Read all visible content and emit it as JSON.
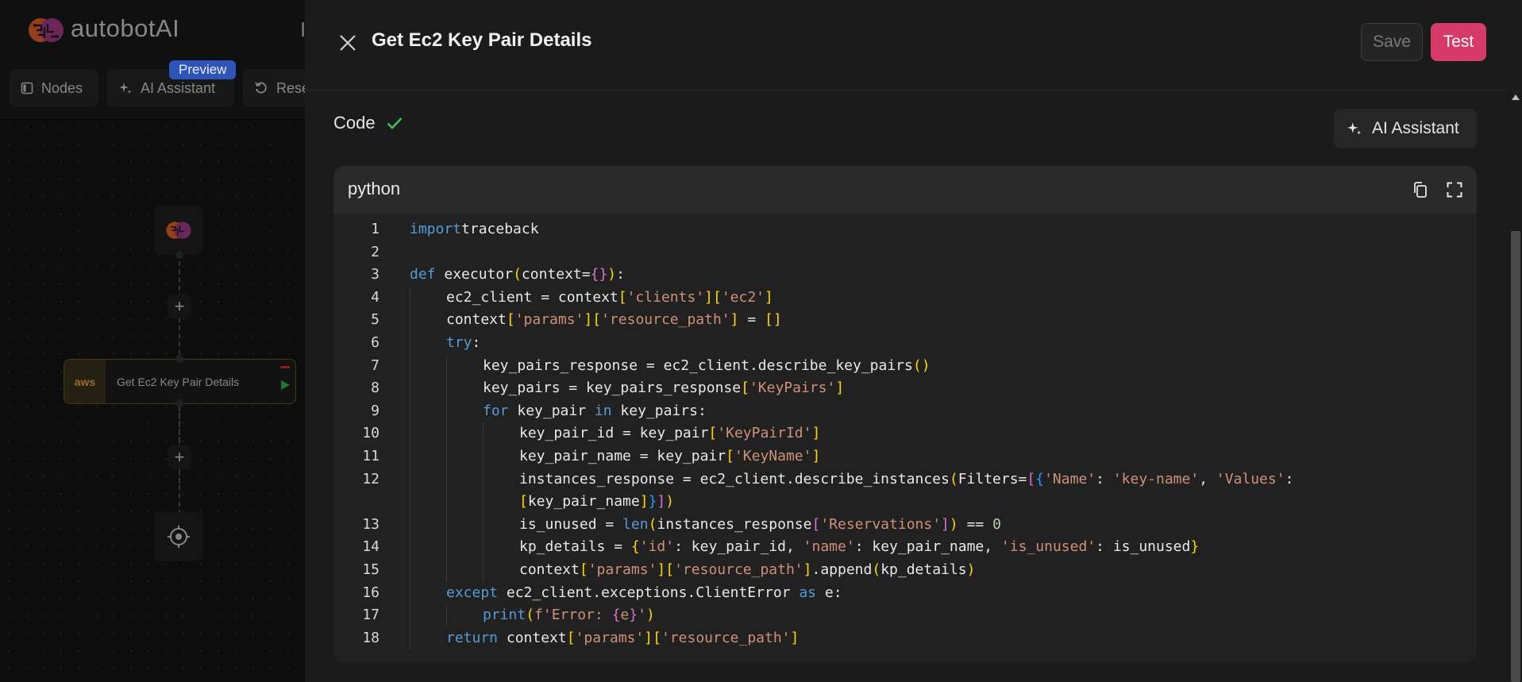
{
  "app": {
    "brand": "autobotAI",
    "header_cut": "I",
    "toolbar": {
      "nodes_label": "Nodes",
      "ai_assistant_label": "AI Assistant",
      "reset_label": "Rese",
      "preview_badge": "Preview"
    },
    "flow": {
      "step_label": "Get Ec2 Key Pair Details",
      "aws_badge": "aws"
    }
  },
  "drawer": {
    "title": "Get Ec2 Key Pair Details",
    "save_label": "Save",
    "test_label": "Test",
    "section_label": "Code",
    "ai_assistant_label": "AI Assistant",
    "editor": {
      "language": "python"
    }
  },
  "colors": {
    "accent": "#d63a68",
    "success": "#3fbf5f",
    "keyword": "#569cd6",
    "string": "#ce9178",
    "number": "#b5cea8",
    "bracket": "#ffd700"
  },
  "code_lines": [
    {
      "n": "1",
      "indent": 0,
      "tokens": [
        [
          "kw",
          "import"
        ],
        [
          "",
          "traceback"
        ]
      ]
    },
    {
      "n": "2",
      "indent": 0,
      "tokens": []
    },
    {
      "n": "3",
      "indent": 0,
      "tokens": [
        [
          "kw",
          "def"
        ],
        [
          "",
          " executor"
        ],
        [
          "br1",
          "("
        ],
        [
          "",
          "context="
        ],
        [
          "br2",
          "{}"
        ],
        [
          "br1",
          ")"
        ],
        [
          "",
          ":"
        ]
      ]
    },
    {
      "n": "4",
      "indent": 1,
      "tokens": [
        [
          "",
          "ec2_client = context"
        ],
        [
          "br1",
          "["
        ],
        [
          "str",
          "'clients'"
        ],
        [
          "br1",
          "]["
        ],
        [
          "str",
          "'ec2'"
        ],
        [
          "br1",
          "]"
        ]
      ]
    },
    {
      "n": "5",
      "indent": 1,
      "tokens": [
        [
          "",
          "context"
        ],
        [
          "br1",
          "["
        ],
        [
          "str",
          "'params'"
        ],
        [
          "br1",
          "]["
        ],
        [
          "str",
          "'resource_path'"
        ],
        [
          "br1",
          "]"
        ],
        [
          "",
          " = "
        ],
        [
          "br1",
          "[]"
        ]
      ]
    },
    {
      "n": "6",
      "indent": 1,
      "tokens": [
        [
          "kw",
          "try"
        ],
        [
          "",
          ":"
        ]
      ]
    },
    {
      "n": "7",
      "indent": 2,
      "tokens": [
        [
          "",
          "key_pairs_response = ec2_client.describe_key_pairs"
        ],
        [
          "br1",
          "()"
        ]
      ]
    },
    {
      "n": "8",
      "indent": 2,
      "tokens": [
        [
          "",
          "key_pairs = key_pairs_response"
        ],
        [
          "br1",
          "["
        ],
        [
          "str",
          "'KeyPairs'"
        ],
        [
          "br1",
          "]"
        ]
      ]
    },
    {
      "n": "9",
      "indent": 2,
      "tokens": [
        [
          "kw",
          "for"
        ],
        [
          "",
          " key_pair "
        ],
        [
          "kw",
          "in"
        ],
        [
          "",
          " key_pairs:"
        ]
      ]
    },
    {
      "n": "10",
      "indent": 3,
      "tokens": [
        [
          "",
          "key_pair_id = key_pair"
        ],
        [
          "br1",
          "["
        ],
        [
          "str",
          "'KeyPairId'"
        ],
        [
          "br1",
          "]"
        ]
      ]
    },
    {
      "n": "11",
      "indent": 3,
      "tokens": [
        [
          "",
          "key_pair_name = key_pair"
        ],
        [
          "br1",
          "["
        ],
        [
          "str",
          "'KeyName'"
        ],
        [
          "br1",
          "]"
        ]
      ]
    },
    {
      "n": "12",
      "indent": 3,
      "tokens": [
        [
          "",
          "instances_response = ec2_client.describe_instances"
        ],
        [
          "br1",
          "("
        ],
        [
          "",
          "Filters="
        ],
        [
          "br2",
          "["
        ],
        [
          "br3",
          "{"
        ],
        [
          "str",
          "'Name'"
        ],
        [
          "",
          ": "
        ],
        [
          "str",
          "'key-name'"
        ],
        [
          "",
          ", "
        ],
        [
          "str",
          "'Values'"
        ],
        [
          "",
          ":"
        ]
      ]
    },
    {
      "n": "",
      "indent": 3,
      "tokens": [
        [
          "br1",
          "["
        ],
        [
          "",
          "key_pair_name"
        ],
        [
          "br1",
          "]"
        ],
        [
          "br3",
          "}"
        ],
        [
          "br2",
          "]"
        ],
        [
          "br1",
          ")"
        ]
      ]
    },
    {
      "n": "13",
      "indent": 3,
      "tokens": [
        [
          "",
          "is_unused = "
        ],
        [
          "bi",
          "len"
        ],
        [
          "br1",
          "("
        ],
        [
          "",
          "instances_response"
        ],
        [
          "br2",
          "["
        ],
        [
          "str",
          "'Reservations'"
        ],
        [
          "br2",
          "]"
        ],
        [
          "br1",
          ")"
        ],
        [
          "",
          " == "
        ],
        [
          "num",
          "0"
        ]
      ]
    },
    {
      "n": "14",
      "indent": 3,
      "tokens": [
        [
          "",
          "kp_details = "
        ],
        [
          "br1",
          "{"
        ],
        [
          "str",
          "'id'"
        ],
        [
          "",
          ": key_pair_id, "
        ],
        [
          "str",
          "'name'"
        ],
        [
          "",
          ": key_pair_name, "
        ],
        [
          "str",
          "'is_unused'"
        ],
        [
          "",
          ": is_unused"
        ],
        [
          "br1",
          "}"
        ]
      ]
    },
    {
      "n": "15",
      "indent": 3,
      "tokens": [
        [
          "",
          "context"
        ],
        [
          "br1",
          "["
        ],
        [
          "str",
          "'params'"
        ],
        [
          "br1",
          "]["
        ],
        [
          "str",
          "'resource_path'"
        ],
        [
          "br1",
          "]"
        ],
        [
          "",
          ".append"
        ],
        [
          "br1",
          "("
        ],
        [
          "",
          "kp_details"
        ],
        [
          "br1",
          ")"
        ]
      ]
    },
    {
      "n": "16",
      "indent": 1,
      "tokens": [
        [
          "kw",
          "except"
        ],
        [
          "",
          " ec2_client.exceptions.ClientError "
        ],
        [
          "kw",
          "as"
        ],
        [
          "",
          " e:"
        ]
      ]
    },
    {
      "n": "17",
      "indent": 2,
      "tokens": [
        [
          "bi",
          "print"
        ],
        [
          "br1",
          "("
        ],
        [
          "str",
          "f'Error: "
        ],
        [
          "br2",
          "{"
        ],
        [
          "str",
          "e"
        ],
        [
          "br2",
          "}"
        ],
        [
          "str",
          "'"
        ],
        [
          "br1",
          ")"
        ]
      ]
    },
    {
      "n": "18",
      "indent": 1,
      "tokens": [
        [
          "kw",
          "return"
        ],
        [
          "",
          " context"
        ],
        [
          "br1",
          "["
        ],
        [
          "str",
          "'params'"
        ],
        [
          "br1",
          "]["
        ],
        [
          "str",
          "'resource_path'"
        ],
        [
          "br1",
          "]"
        ]
      ]
    }
  ]
}
